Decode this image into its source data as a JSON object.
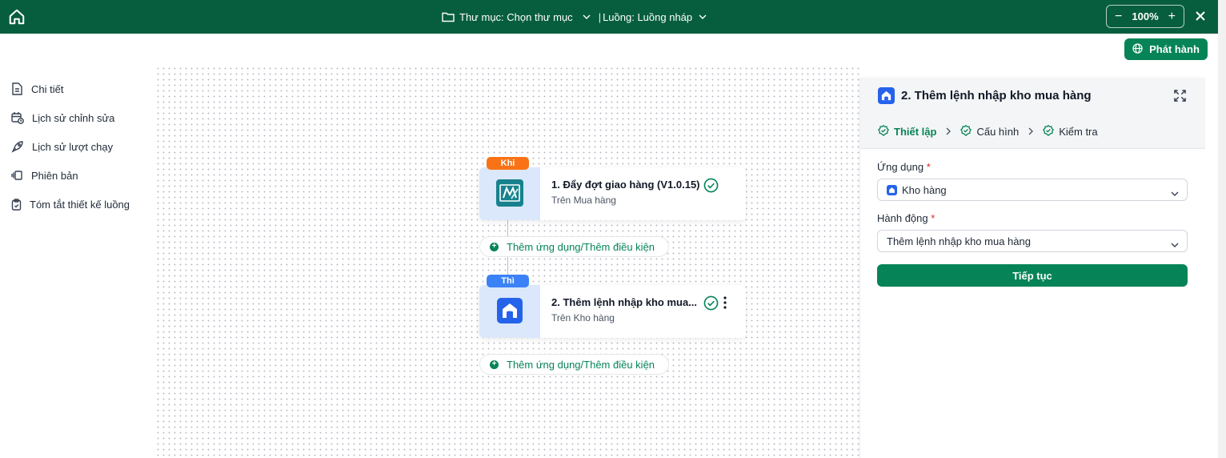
{
  "topbar": {
    "folder_label": "Thư mục: Chọn thư mục",
    "flow_label": "Luồng: Luồng nháp",
    "zoom_value": "100%",
    "zoom_minus": "−",
    "zoom_plus": "+"
  },
  "header": {
    "publish_label": "Phát hành"
  },
  "sidebar": {
    "items": [
      {
        "label": "Chi tiết",
        "icon": "document-icon"
      },
      {
        "label": "Lịch sử chỉnh sửa",
        "icon": "calendar-clock-icon"
      },
      {
        "label": "Lịch sử lượt chạy",
        "icon": "rocket-icon"
      },
      {
        "label": "Phiên bản",
        "icon": "versions-icon"
      },
      {
        "label": "Tóm tắt thiết kế luồng",
        "icon": "clipboard-icon"
      }
    ]
  },
  "canvas": {
    "trigger_tag": "Khi",
    "action_tag": "Thì",
    "nodes": [
      {
        "title": "1.  Đẩy đợt giao hàng (V1.0.15)",
        "subtitle": "Trên Mua hàng"
      },
      {
        "title": "2.  Thêm lệnh nhập kho mua...",
        "subtitle": "Trên Kho hàng"
      }
    ],
    "add_label": "Thêm ứng dụng/Thêm điều kiện"
  },
  "panel": {
    "title": "2. Thêm lệnh nhập kho mua hàng",
    "steps": [
      "Thiết lập",
      "Cấu hình",
      "Kiểm tra"
    ],
    "app_label": "Ứng dụng",
    "app_value": "Kho hàng",
    "action_label": "Hành động",
    "action_value": "Thêm lệnh nhập kho mua hàng",
    "required_mark": "*",
    "continue_label": "Tiếp tục"
  },
  "colors": {
    "topbar": "#075e3e",
    "primary": "#068457",
    "trigger_tag": "#f97316",
    "action_tag": "#3b82f6"
  }
}
